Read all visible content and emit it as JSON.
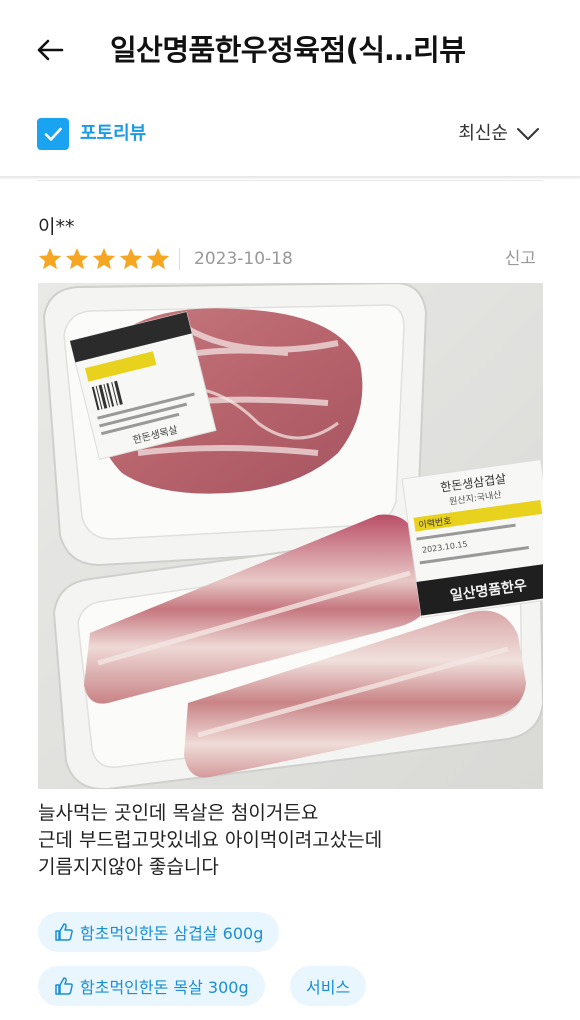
{
  "header": {
    "title": "일산명품한우정육점(식…리뷰"
  },
  "filter": {
    "photo_review_label": "포토리뷰",
    "photo_review_checked": true,
    "sort_label": "최신순"
  },
  "review": {
    "reviewer": "이**",
    "rating": 5,
    "rating_max": 5,
    "date": "2023-10-18",
    "report_label": "신고",
    "text_lines": [
      "늘사먹는 곳인데 목살은 첨이거든요",
      "근데 부드럽고맛있네요 아이먹이려고샀는데",
      "기름지지않아 좋습니다"
    ],
    "tags": [
      {
        "label": "함초먹인한돈 삼겹살 600g",
        "icon": "thumbs-up-icon"
      },
      {
        "label": "함초먹인한돈 목살 300g",
        "icon": "thumbs-up-icon"
      },
      {
        "label": "서비스",
        "icon": ""
      }
    ],
    "photo_label_text": {
      "tray1_label": "한돈생목살",
      "tray2_label_top": "한돈생삼겹살",
      "tray2_label_sub": "원산지:국내산",
      "tray2_label_tag": "이력번호",
      "tray2_label_dates": "2023.10.15",
      "store_band": "일산명품한우"
    }
  },
  "colors": {
    "accent": "#1aa3f0",
    "star": "#f5a623",
    "tag_bg": "#eaf6fd",
    "tag_text": "#1b8ed6"
  }
}
